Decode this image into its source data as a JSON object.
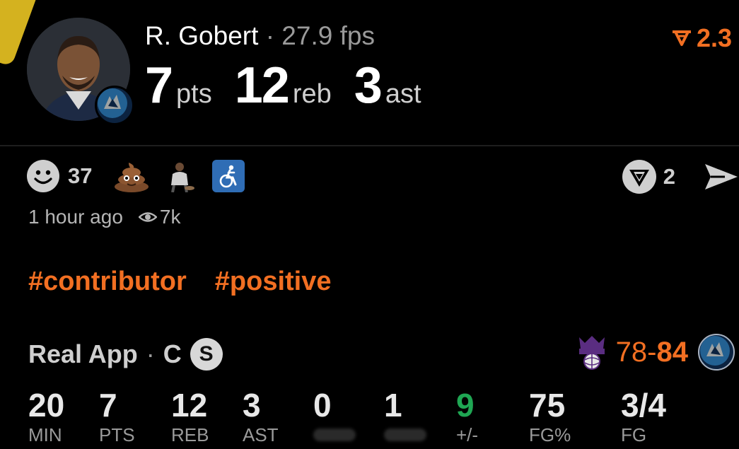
{
  "header": {
    "player_name": "R. Gobert",
    "separator": "·",
    "fps": "27.9 fps",
    "stats": [
      {
        "value": "7",
        "unit": "pts"
      },
      {
        "value": "12",
        "unit": "reb"
      },
      {
        "value": "3",
        "unit": "ast"
      }
    ],
    "rating": "2.3"
  },
  "reactions": {
    "smiley_count": "37",
    "share_count": "2"
  },
  "meta": {
    "time_ago": "1 hour ago",
    "views": "7k"
  },
  "tags": [
    "#contributor",
    "#positive"
  ],
  "game": {
    "source_label": "Real App",
    "dot": "·",
    "position": "C",
    "s_badge": "S",
    "score_away": "78",
    "score_dash": "-",
    "score_home": "84",
    "box": [
      {
        "value": "20",
        "label": "MIN"
      },
      {
        "value": "7",
        "label": "PTS"
      },
      {
        "value": "12",
        "label": "REB"
      },
      {
        "value": "3",
        "label": "AST"
      },
      {
        "value": "0",
        "label": ""
      },
      {
        "value": "1",
        "label": ""
      },
      {
        "value": "9",
        "label": "+/-"
      },
      {
        "value": "75",
        "label": "FG%"
      },
      {
        "value": "3/4",
        "label": "FG"
      }
    ]
  },
  "colors": {
    "accent": "#f26f22",
    "plus_minus_positive": "#1fa653",
    "background": "#000000"
  }
}
